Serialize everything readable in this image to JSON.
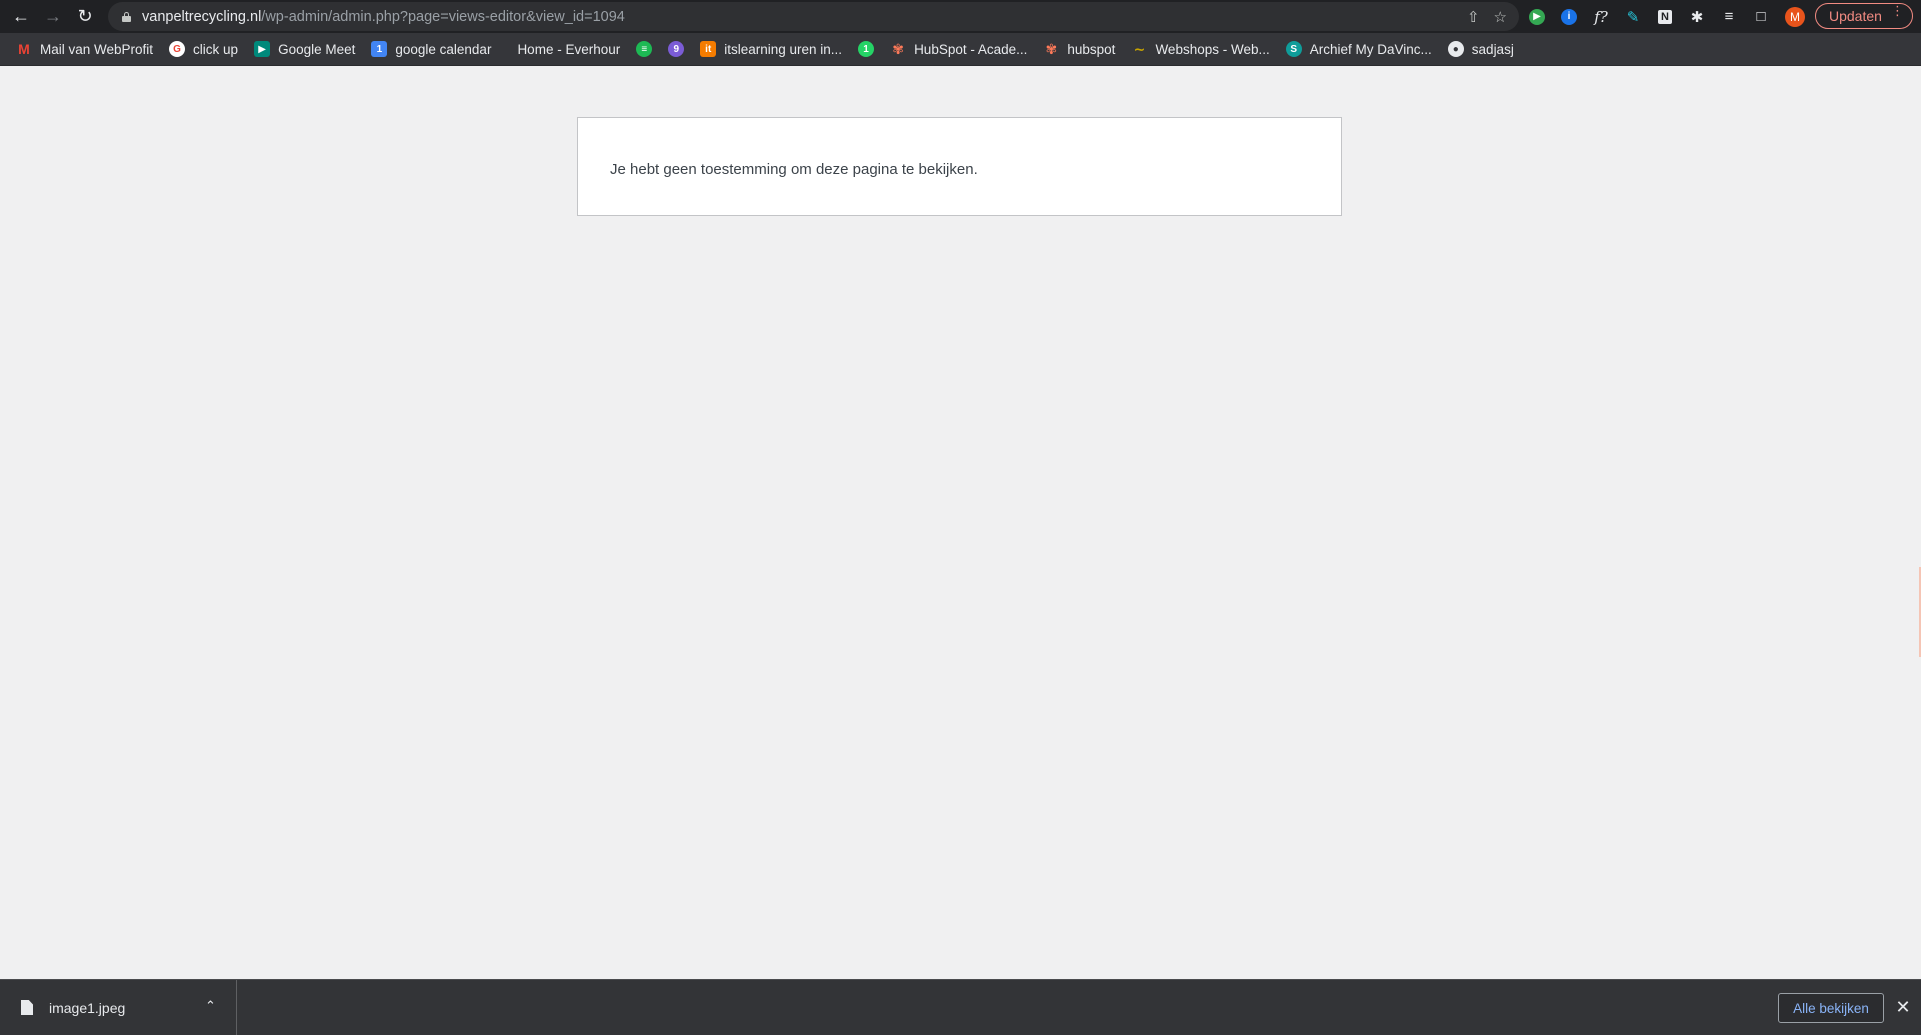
{
  "browser": {
    "url_host": "vanpeltrecycling.nl",
    "url_path": "/wp-admin/admin.php?page=views-editor&view_id=1094",
    "update_label": "Updaten",
    "avatar_initial": "M",
    "extensions": [
      "play-icon",
      "info-icon",
      "function-icon",
      "pen-icon",
      "notion-icon",
      "puzzle-icon",
      "reading-list-icon",
      "side-panel-icon"
    ]
  },
  "bookmarks": [
    {
      "label": "Mail van WebProfit",
      "icon": "gmail-icon",
      "color": "#ea4335"
    },
    {
      "label": "click up",
      "icon": "google-icon",
      "color": "#ffffff"
    },
    {
      "label": "Google Meet",
      "icon": "meet-icon",
      "color": "#00897b"
    },
    {
      "label": "google calendar",
      "icon": "calendar-icon",
      "color": "#4285f4"
    },
    {
      "label": "Home - Everhour",
      "icon": "everhour-icon",
      "color": "#35363a"
    },
    {
      "label": "",
      "icon": "spotify-icon",
      "color": "#1db954"
    },
    {
      "label": "",
      "icon": "app-icon",
      "color": "#7b5cd6"
    },
    {
      "label": "itslearning uren in...",
      "icon": "itslearning-icon",
      "color": "#f57c00"
    },
    {
      "label": "",
      "icon": "whatsapp-icon",
      "color": "#25d366"
    },
    {
      "label": "HubSpot - Acade...",
      "icon": "hubspot-icon",
      "color": "#ff7a59"
    },
    {
      "label": "hubspot",
      "icon": "hubspot-icon",
      "color": "#ff7a59"
    },
    {
      "label": "Webshops - Web...",
      "icon": "chart-icon",
      "color": "#c8a400"
    },
    {
      "label": "Archief My DaVinc...",
      "icon": "davinci-icon",
      "color": "#0f9d9a"
    },
    {
      "label": "sadjasj",
      "icon": "globe-icon",
      "color": "#e8eaed"
    }
  ],
  "page": {
    "message": "Je hebt geen toestemming om deze pagina te bekijken."
  },
  "downloads": {
    "file_name": "image1.jpeg",
    "show_all_label": "Alle bekijken"
  }
}
